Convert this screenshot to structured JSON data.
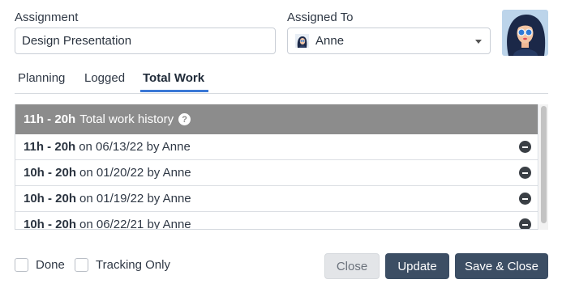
{
  "form": {
    "assignment_label": "Assignment",
    "assignment_value": "Design Presentation",
    "assigned_to_label": "Assigned To",
    "assigned_to_value": "Anne"
  },
  "tabs": [
    {
      "label": "Planning",
      "active": false
    },
    {
      "label": "Logged",
      "active": false
    },
    {
      "label": "Total Work",
      "active": true
    }
  ],
  "history": {
    "header_range": "11h - 20h",
    "header_text": "Total work history",
    "entries": [
      {
        "range": "11h - 20h",
        "meta": "on 06/13/22 by Anne"
      },
      {
        "range": "10h - 20h",
        "meta": "on 01/20/22 by Anne"
      },
      {
        "range": "10h - 20h",
        "meta": "on 01/19/22 by Anne"
      },
      {
        "range": "10h - 20h",
        "meta": "on 06/22/21 by Anne"
      }
    ]
  },
  "footer": {
    "done_label": "Done",
    "tracking_label": "Tracking Only",
    "close_label": "Close",
    "update_label": "Update",
    "save_close_label": "Save & Close"
  },
  "icons": {
    "help": "question-icon",
    "remove": "minus-circle-icon",
    "dropdown": "chevron-down-icon"
  },
  "colors": {
    "accent": "#3a78d6",
    "primary_button": "#3c4e64",
    "header_bg": "#8c8c8c"
  }
}
